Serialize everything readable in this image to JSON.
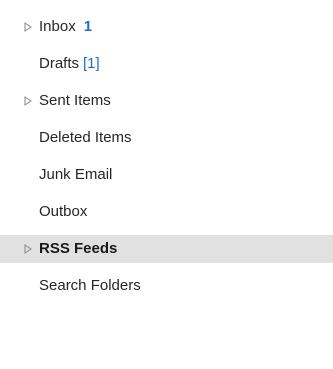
{
  "folders": [
    {
      "label": "Inbox",
      "unread": "1",
      "expandable": true
    },
    {
      "label": "Drafts",
      "count": "[1]",
      "expandable": false
    },
    {
      "label": "Sent Items",
      "expandable": true
    },
    {
      "label": "Deleted Items",
      "expandable": false
    },
    {
      "label": "Junk Email",
      "expandable": false
    },
    {
      "label": "Outbox",
      "expandable": false
    },
    {
      "label": "RSS Feeds",
      "expandable": true,
      "selected": true
    },
    {
      "label": "Search Folders",
      "expandable": false
    }
  ],
  "colors": {
    "unread_accent": "#1e6fc1",
    "selected_background": "#e1e1e1",
    "expander_stroke": "#8a8a8a"
  },
  "icons": {
    "expander": "chevron-right-outline-icon"
  }
}
